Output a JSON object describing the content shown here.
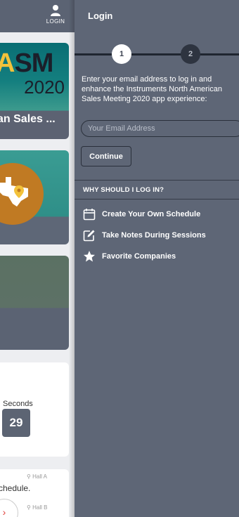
{
  "background_app": {
    "login_label": "LOGIN",
    "card1": {
      "brand_text_a": "A",
      "brand_text_b": "SM",
      "year": "2020",
      "caption": "an Sales ..."
    },
    "card4": {
      "seconds_label": "Seconds",
      "seconds_value": "29"
    },
    "card5": {
      "hall_a": "Hall A",
      "schedule_text": "chedule.",
      "hall_b": "Hall B",
      "arrow": "›"
    }
  },
  "panel": {
    "title": "Login",
    "steps": [
      "1",
      "2"
    ],
    "intro_text": "Enter your email address to log in and enhance the Instruments North American Sales Meeting 2020 app experience:",
    "email_placeholder": "Your Email Address",
    "email_value": "",
    "continue_label": "Continue",
    "why_heading": "WHY SHOULD I LOG IN?",
    "benefits": [
      {
        "icon": "calendar-icon",
        "label": "Create Your Own Schedule"
      },
      {
        "icon": "edit-note-icon",
        "label": "Take Notes During Sessions"
      },
      {
        "icon": "star-icon",
        "label": "Favorite Companies"
      }
    ]
  },
  "colors": {
    "panel_bg": "#5e6676",
    "accent_yellow": "#f3c23b",
    "texas_orange": "#c07a23",
    "countdown_box": "#5c6473"
  }
}
